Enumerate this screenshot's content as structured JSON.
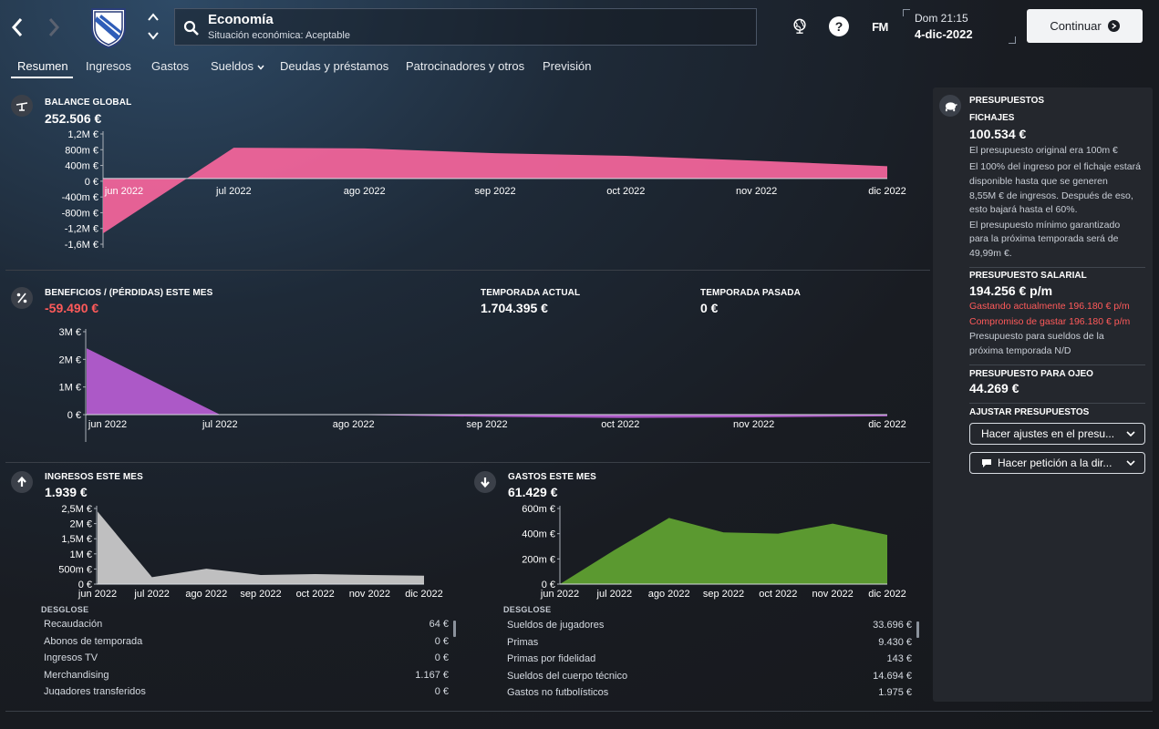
{
  "header": {
    "title": "Economía",
    "subtitle": "Situación económica: Aceptable",
    "fm_logo": "FM",
    "help": "?",
    "date_day": "Dom 21:15",
    "date_date": "4-dic-2022",
    "continue_label": "Continuar"
  },
  "tabs": [
    {
      "label": "Resumen",
      "active": true
    },
    {
      "label": "Ingresos"
    },
    {
      "label": "Gastos"
    },
    {
      "label": "Sueldos",
      "has_dropdown": true
    },
    {
      "label": "Deudas y préstamos"
    },
    {
      "label": "Patrocinadores y otros"
    },
    {
      "label": "Previsión"
    }
  ],
  "balance": {
    "label": "BALANCE GLOBAL",
    "value": "252.506 €",
    "chart_color": "#f0649a"
  },
  "profit": {
    "label": "BENEFICIOS / (PÉRDIDAS) ESTE MES",
    "value": "-59.490 €",
    "season_current_label": "TEMPORADA ACTUAL",
    "season_current_value": "1.704.395 €",
    "season_last_label": "TEMPORADA PASADA",
    "season_last_value": "0 €",
    "chart_color": "#b45cd0"
  },
  "income": {
    "label": "INGRESOS ESTE MES",
    "value": "1.939 €",
    "chart_color": "#c8c8c8",
    "desglose_title": "DESGLOSE",
    "desglose": [
      {
        "label": "Recaudación",
        "value": "64 €"
      },
      {
        "label": "Abonos de temporada",
        "value": "0 €"
      },
      {
        "label": "Ingresos TV",
        "value": "0 €"
      },
      {
        "label": "Merchandising",
        "value": "1.167 €"
      },
      {
        "label": "Jugadores transferidos",
        "value": "0 €"
      }
    ]
  },
  "expenses": {
    "label": "GASTOS ESTE MES",
    "value": "61.429 €",
    "chart_color": "#5fa032",
    "desglose_title": "DESGLOSE",
    "desglose": [
      {
        "label": "Sueldos de jugadores",
        "value": "33.696 €"
      },
      {
        "label": "Primas",
        "value": "9.430 €"
      },
      {
        "label": "Primas por fidelidad",
        "value": "143 €"
      },
      {
        "label": "Sueldos del cuerpo técnico",
        "value": "14.694 €"
      },
      {
        "label": "Gastos no futbolísticos",
        "value": "1.975 €"
      }
    ]
  },
  "panel": {
    "title": "PRESUPUESTOS",
    "fichajes_label": "FICHAJES",
    "fichajes_value": "100.534 €",
    "fichajes_lines": [
      "El presupuesto original era 100m €",
      "El 100% del ingreso por el fichaje estará",
      "disponible hasta que se generen",
      "8,55M € de ingresos. Después de eso,",
      "esto bajará hasta el 60%.",
      "El presupuesto mínimo garantizado",
      "para la próxima temporada será de",
      "49,99m €."
    ],
    "salarial_label": "PRESUPUESTO SALARIAL",
    "salarial_value": "194.256 € p/m",
    "salarial_spending": "Gastando actualmente 196.180 € p/m",
    "salarial_commit": "Compromiso de gastar 196.180 € p/m",
    "salarial_lines": [
      "Presupuesto para sueldos de la",
      "próxima temporada N/D"
    ],
    "ojeo_label": "PRESUPUESTO PARA OJEO",
    "ojeo_value": "44.269 €",
    "ajustar_label": "AJUSTAR PRESUPUESTOS",
    "ajustes_btn": "Hacer ajustes en el presu...",
    "peticion_btn": "Hacer petición a la dir..."
  },
  "chart_data": [
    {
      "type": "area",
      "title": "BALANCE GLOBAL",
      "x": [
        "jun 2022",
        "jul 2022",
        "ago 2022",
        "sep 2022",
        "oct 2022",
        "nov 2022",
        "dic 2022"
      ],
      "y_ticks": [
        "1,2M €",
        "800m €",
        "400m €",
        "0 €",
        "-400m €",
        "-800m €",
        "-1,2M €",
        "-1,6M €"
      ],
      "ylim": [
        -1600,
        1200
      ],
      "y_units": "m €",
      "points": [
        [
          0,
          -1480
        ],
        [
          1,
          830
        ],
        [
          2,
          810
        ],
        [
          3,
          680
        ],
        [
          4,
          610
        ],
        [
          5,
          480
        ],
        [
          6,
          330
        ]
      ]
    },
    {
      "type": "area",
      "title": "BENEFICIOS / (PÉRDIDAS) ESTE MES",
      "x": [
        "jun 2022",
        "jul 2022",
        "ago 2022",
        "sep 2022",
        "oct 2022",
        "nov 2022",
        "dic 2022"
      ],
      "y_ticks": [
        "3M €",
        "2M €",
        "1M €",
        "0 €"
      ],
      "ylim": [
        0,
        3000
      ],
      "y_units": "m €",
      "points": [
        [
          0,
          2400
        ],
        [
          1,
          0
        ],
        [
          2,
          -10
        ],
        [
          3,
          -80
        ],
        [
          4,
          -120
        ],
        [
          5,
          -100
        ],
        [
          6,
          -60
        ]
      ]
    },
    {
      "type": "area",
      "title": "INGRESOS ESTE MES",
      "x": [
        "jun 2022",
        "jul 2022",
        "ago 2022",
        "sep 2022",
        "oct 2022",
        "nov 2022",
        "dic 2022"
      ],
      "y_ticks": [
        "2,5M €",
        "2M €",
        "1,5M €",
        "1M €",
        "500m €",
        "0 €"
      ],
      "ylim": [
        0,
        2500
      ],
      "y_units": "m €",
      "points": [
        [
          0,
          2400
        ],
        [
          1,
          230
        ],
        [
          2,
          510
        ],
        [
          3,
          300
        ],
        [
          4,
          330
        ],
        [
          5,
          300
        ],
        [
          6,
          280
        ]
      ]
    },
    {
      "type": "area",
      "title": "GASTOS ESTE MES",
      "x": [
        "jun 2022",
        "jul 2022",
        "ago 2022",
        "sep 2022",
        "oct 2022",
        "nov 2022",
        "dic 2022"
      ],
      "y_ticks": [
        "600m €",
        "400m €",
        "200m €",
        "0 €"
      ],
      "ylim": [
        0,
        600
      ],
      "y_units": "m €",
      "points": [
        [
          0,
          0
        ],
        [
          1,
          270
        ],
        [
          2,
          525
        ],
        [
          3,
          410
        ],
        [
          4,
          400
        ],
        [
          5,
          480
        ],
        [
          6,
          390
        ]
      ]
    }
  ]
}
